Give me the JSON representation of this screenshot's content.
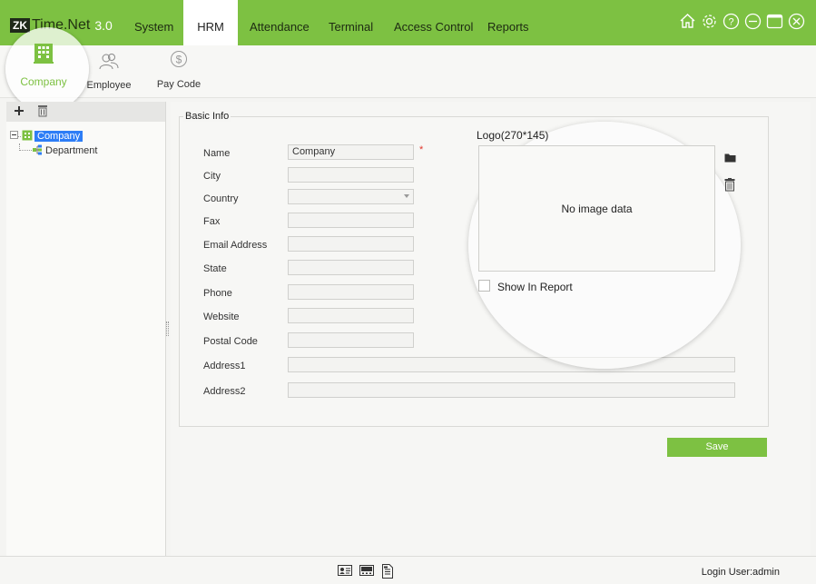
{
  "app": {
    "brand_logo": "ZK",
    "brand_name": "Time.Net",
    "version": "3.0"
  },
  "menu": {
    "items": [
      {
        "label": "System"
      },
      {
        "label": "HRM"
      },
      {
        "label": "Attendance"
      },
      {
        "label": "Terminal"
      },
      {
        "label": "Access Control"
      },
      {
        "label": "Reports"
      }
    ],
    "active": "HRM"
  },
  "window_icons": [
    "home-icon",
    "settings-icon",
    "help-icon",
    "minimize-icon",
    "maximize-icon",
    "close-icon"
  ],
  "ribbon": {
    "items": [
      {
        "label": "Company",
        "icon": "company-icon"
      },
      {
        "label": "Employee",
        "icon": "employee-icon"
      },
      {
        "label": "Pay Code",
        "icon": "pay-code-icon"
      }
    ]
  },
  "tree": {
    "root": "Company",
    "children": [
      "Department"
    ]
  },
  "form": {
    "section_title": "Basic Info",
    "fields": [
      {
        "label": "Name",
        "value": "Company",
        "required_mark": "*"
      },
      {
        "label": "City",
        "value": ""
      },
      {
        "label": "Country",
        "value": ""
      },
      {
        "label": "Fax",
        "value": ""
      },
      {
        "label": "Email Address",
        "value": ""
      },
      {
        "label": "State",
        "value": ""
      },
      {
        "label": "Phone",
        "value": ""
      },
      {
        "label": "Website",
        "value": ""
      },
      {
        "label": "Postal Code",
        "value": ""
      },
      {
        "label": "Address1",
        "value": ""
      },
      {
        "label": "Address2",
        "value": ""
      }
    ],
    "logo_title": "Logo(270*145)",
    "logo_placeholder": "No image data",
    "show_in_report_label": "Show In Report",
    "show_in_report": false,
    "save_label": "Save"
  },
  "status": {
    "login": "Login User:admin"
  },
  "colors": {
    "accent": "#7dc142",
    "selection": "#2d7df6",
    "required": "#e0362b"
  }
}
